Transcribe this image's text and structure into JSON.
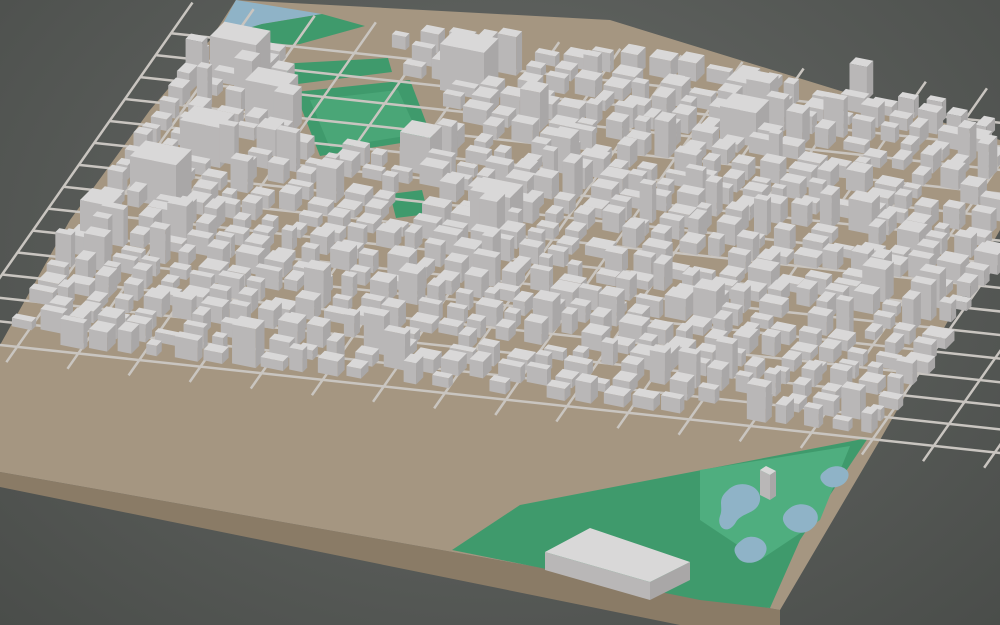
{
  "scene": {
    "type": "3d-city-block-model",
    "colors": {
      "background": "#5a5d5a",
      "base_top": "#a59681",
      "base_side": "#8a7b66",
      "building_roof": "#d9d8d8",
      "building_left": "#b9b7b7",
      "building_right": "#a9a7a7",
      "park": "#3f9a6c",
      "park_light": "#58b383",
      "water": "#8fb3c7",
      "street": "#c9c5c0"
    },
    "features": [
      "city-blocks",
      "street-grid",
      "sports-field",
      "square",
      "park",
      "pond",
      "stadium",
      "river"
    ]
  }
}
